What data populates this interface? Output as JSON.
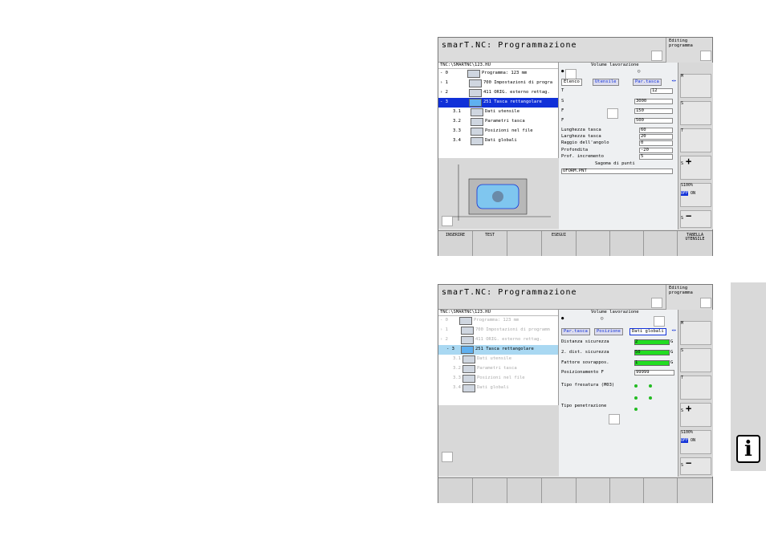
{
  "s1": {
    "title": "smarT.NC: Programmazione",
    "mode": [
      "Editing",
      "programma"
    ],
    "path": "TNC:\\SMARTNC\\123.HU",
    "tree": [
      {
        "n": "- 0",
        "label": "Programma: 123 mm"
      },
      {
        "n": "› 1",
        "label": "700 Impostazioni di progra"
      },
      {
        "n": "› 2",
        "label": "411 ORIG. esterno rettag."
      },
      {
        "n": "- 3",
        "label": "251 Tasca rettangolare"
      },
      {
        "n": "3.1",
        "label": "Dati utensile"
      },
      {
        "n": "3.2",
        "label": "Parametri tasca"
      },
      {
        "n": "3.3",
        "label": "Posizioni nel file"
      },
      {
        "n": "3.4",
        "label": "Dati globali"
      }
    ],
    "vol": "Volume lavorazione",
    "tabs": [
      "Elenco",
      "Utensile",
      "Par.tasca"
    ],
    "fields": [
      {
        "k": "T",
        "v": "12"
      },
      {
        "k": "S",
        "v": "3000"
      },
      {
        "k": "F",
        "v": "150"
      },
      {
        "k": "F",
        "v": "500"
      }
    ],
    "params": [
      {
        "label": "Lunghezza tasca",
        "v": "60"
      },
      {
        "label": "Larghezza tasca",
        "v": "20"
      },
      {
        "label": "Raggio dell'angolo",
        "v": "0"
      },
      {
        "label": "Profondita",
        "v": "-20"
      },
      {
        "label": "Prof. incremento",
        "v": "5"
      }
    ],
    "pattern_title": "Sagoma di punti",
    "pattern_file": "UFORM.PNT",
    "softkeys": [
      "INSERIRE",
      "TEST",
      "",
      "ESEGUI",
      "",
      "",
      "",
      "TABELLA UTENSILE"
    ],
    "side": [
      "M",
      "S",
      "T",
      "S",
      "S100%",
      "S"
    ],
    "off": "OFF",
    "on": "ON"
  },
  "s2": {
    "title": "smarT.NC: Programmazione",
    "mode": [
      "Editing",
      "programma"
    ],
    "path": "TNC:\\SMARTNC\\123.HU",
    "tree": [
      {
        "n": "- 0",
        "label": "Programma: 123 mm"
      },
      {
        "n": "› 1",
        "label": "700 Impostazioni di programm"
      },
      {
        "n": "› 2",
        "label": "411 ORIG. esterno rettag."
      },
      {
        "n": "- 3",
        "label": "251 Tasca rettangolare"
      },
      {
        "n": "3.1",
        "label": "Dati utensile"
      },
      {
        "n": "3.2",
        "label": "Parametri tasca"
      },
      {
        "n": "3.3",
        "label": "Posizioni nel file"
      },
      {
        "n": "3.4",
        "label": "Dati globali"
      }
    ],
    "vol": "Volume lavorazione",
    "tabs": [
      "Par.tasca",
      "Posizione",
      "Dati globali"
    ],
    "glob": [
      {
        "label": "Distanza sicurezza",
        "v": "2"
      },
      {
        "label": "2. dist. sicurezza",
        "v": "50"
      },
      {
        "label": "Fattore sovrappos.",
        "v": "1"
      },
      {
        "label": "Posizionamento F",
        "v": "99999"
      }
    ],
    "g_unit": "G",
    "fres": "Tipo fresatura (M03)",
    "pen": "Tipo penetrazione",
    "side": [
      "M",
      "S",
      "T",
      "S",
      "S100%",
      "S"
    ],
    "off": "OFF",
    "on": "ON"
  },
  "info_letter": "i"
}
